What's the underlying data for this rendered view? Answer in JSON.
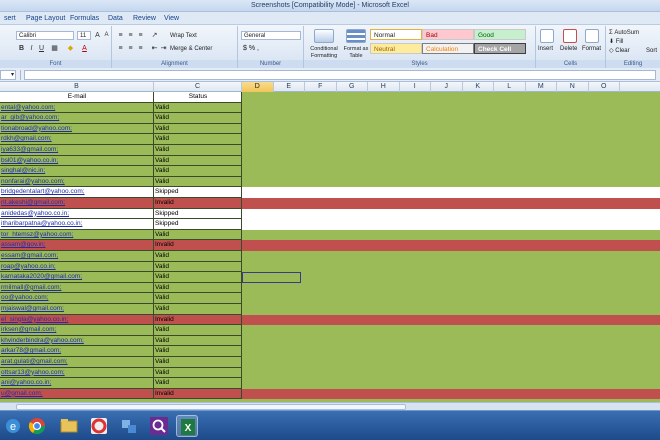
{
  "window": {
    "title": "Screenshots  [Compatibility Mode]  -  Microsoft Excel"
  },
  "menu": {
    "tabs": [
      "sert",
      "Page Layout",
      "Formulas",
      "Data",
      "Review",
      "View"
    ]
  },
  "ribbon": {
    "font": {
      "name": "Calibri",
      "size": "11",
      "label": "Font"
    },
    "alignment": {
      "wrap_text": "Wrap Text",
      "merge_center": "Merge & Center",
      "label": "Alignment"
    },
    "number": {
      "format": "General",
      "symbols": "$ % ,",
      "label": "Number"
    },
    "styles": {
      "conditional": "Conditional Formatting",
      "format_table": "Format as Table",
      "normal": "Normal",
      "bad": "Bad",
      "good": "Good",
      "neutral": "Neutral",
      "calculation": "Calculation",
      "check_cell": "Check Cell",
      "label": "Styles"
    },
    "cells": {
      "insert": "Insert",
      "delete": "Delete",
      "format": "Format",
      "label": "Cells"
    },
    "editing": {
      "autosum": "AutoSum",
      "fill": "Fill",
      "clear": "Clear",
      "sort": "Sort",
      "label": "Editing"
    }
  },
  "formula_bar": {
    "name_box": "",
    "value": ""
  },
  "columns": [
    "B",
    "C",
    "D",
    "E",
    "F",
    "G",
    "H",
    "I",
    "J",
    "K",
    "L",
    "M",
    "N",
    "O"
  ],
  "table": {
    "headers": {
      "email": "E-mail",
      "status": "Status"
    },
    "rows": [
      {
        "email": "ental@yahoo.com;",
        "status": "Valid",
        "kind": "green"
      },
      {
        "email": "ar_gib@yahoo.com;",
        "status": "Valid",
        "kind": "green"
      },
      {
        "email": "tionabroad@yahoo.com;",
        "status": "Valid",
        "kind": "green"
      },
      {
        "email": "rdkh@gmail.com;",
        "status": "Valid",
        "kind": "green"
      },
      {
        "email": "iya633@gmail.com;",
        "status": "Valid",
        "kind": "green"
      },
      {
        "email": "bsl01@yahoo.co.in;",
        "status": "Valid",
        "kind": "green"
      },
      {
        "email": "singhal@nic.in;",
        "status": "Valid",
        "kind": "green"
      },
      {
        "email": "nonfarai@yahoo.com;",
        "status": "Valid",
        "kind": "green"
      },
      {
        "email": "bridgedentalart@yahoo.com;",
        "status": "Skipped",
        "kind": "white"
      },
      {
        "email": "nt.akeshi@gmail.com;",
        "status": "Invalid",
        "kind": "red"
      },
      {
        "email": "anidedas@yahoo.co.in;",
        "status": "Skipped",
        "kind": "white"
      },
      {
        "email": "itharibarpatna@yahoo.co.in;",
        "status": "Skipped",
        "kind": "white"
      },
      {
        "email": "tor_htemsz@yahoo.com;",
        "status": "Valid",
        "kind": "green"
      },
      {
        "email": "assam@gov.in;",
        "status": "Invalid",
        "kind": "red"
      },
      {
        "email": "essam@gmail.com;",
        "status": "Valid",
        "kind": "green"
      },
      {
        "email": "roap@yahoo.co.in;",
        "status": "Valid",
        "kind": "green"
      },
      {
        "email": "karnataka2020@gmail.com;",
        "status": "Valid",
        "kind": "green"
      },
      {
        "email": "rmilmall@gmail.com;",
        "status": "Valid",
        "kind": "green"
      },
      {
        "email": "oo@yahoo.com;",
        "status": "Valid",
        "kind": "green"
      },
      {
        "email": "mjaiswal@gmail.com;",
        "status": "Valid",
        "kind": "green"
      },
      {
        "email": "el_singla@yahoo.co.in;",
        "status": "Invalid",
        "kind": "red"
      },
      {
        "email": "irksen@gmail.com;",
        "status": "Valid",
        "kind": "green"
      },
      {
        "email": "khvinderbindra@yahoo.com;",
        "status": "Valid",
        "kind": "green"
      },
      {
        "email": "arkar78@gmail.com;",
        "status": "Valid",
        "kind": "green"
      },
      {
        "email": "arat.gulati@gmail.com;",
        "status": "Valid",
        "kind": "green"
      },
      {
        "email": "ottsar13@yahoo.com;",
        "status": "Valid",
        "kind": "green"
      },
      {
        "email": "ani@yahoo.co.in;",
        "status": "Valid",
        "kind": "green"
      },
      {
        "email": "u@gmail.com;",
        "status": "Invalid",
        "kind": "red"
      }
    ]
  },
  "colors": {
    "valid": "#9bbb59",
    "invalid": "#c0504d",
    "skipped": "#ffffff",
    "link": "#1f2ea8"
  },
  "taskbar": {
    "icons": [
      "ie-icon",
      "chrome-icon",
      "explorer-icon",
      "lifebuoy-icon",
      "puzzle-icon",
      "search-app-icon",
      "excel-icon"
    ]
  }
}
